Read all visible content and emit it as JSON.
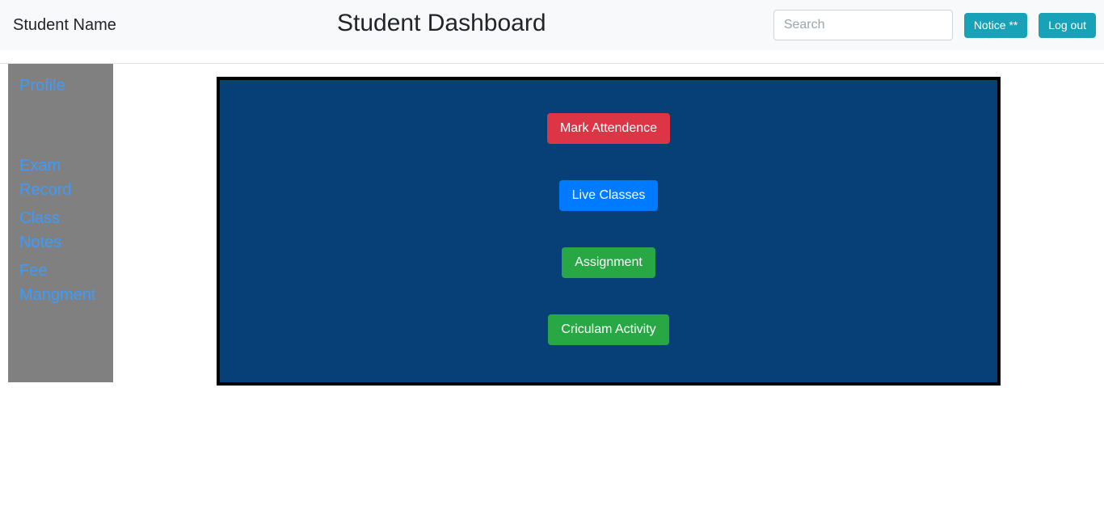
{
  "header": {
    "brand": "Student Name",
    "title": "Student Dashboard",
    "search": {
      "value": "",
      "placeholder": "Search"
    },
    "notice_label": "Notice **",
    "logout_label": "Log out",
    "background": "#f8f9fa",
    "button_color": "#17a2b8"
  },
  "sidebar": {
    "background": "#808080",
    "link_color": "#3d9bfd",
    "items": [
      {
        "label": "Profile"
      },
      {
        "label": ""
      },
      {
        "label": "Exam Record"
      },
      {
        "label": "Class Notes"
      },
      {
        "label": "Fee Mangment"
      }
    ]
  },
  "main": {
    "panel_background": "#074077",
    "panel_border_color": "#000000",
    "buttons": [
      {
        "label": "Mark Attendence",
        "color": "#dc3545"
      },
      {
        "label": "Live Classes",
        "color": "#007bff"
      },
      {
        "label": "Assignment",
        "color": "#28a745"
      },
      {
        "label": "Criculam Activity",
        "color": "#28a745"
      }
    ]
  }
}
